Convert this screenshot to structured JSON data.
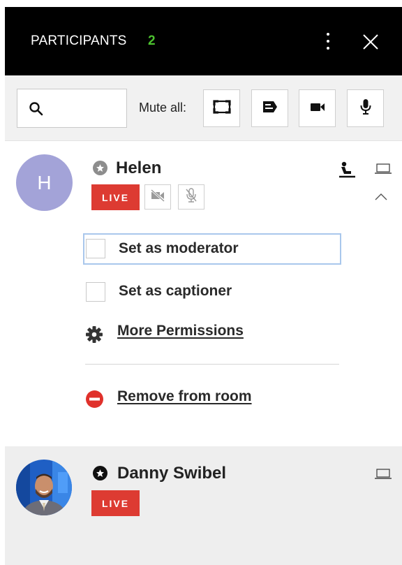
{
  "header": {
    "title": "PARTICIPANTS",
    "count": "2"
  },
  "toolbar": {
    "search_value": "",
    "search_placeholder": "",
    "mute_all_label": "Mute all:"
  },
  "participants": [
    {
      "initial": "H",
      "name": "Helen",
      "live_label": "LIVE",
      "avatar_color": "#a3a3d8",
      "star_icon": "star-circle-outline-icon",
      "expanded": true
    },
    {
      "name": "Danny Swibel",
      "live_label": "LIVE",
      "star_icon": "star-circle-filled-icon"
    }
  ],
  "menu": {
    "set_moderator": "Set as moderator",
    "set_captioner": "Set as captioner",
    "more_permissions": "More Permissions",
    "remove_from_room": "Remove from room"
  },
  "colors": {
    "accent_green": "#4cc12f",
    "live_red": "#dd3b32",
    "remove_red": "#e0312b",
    "focus_outline": "#a9c7ec"
  }
}
